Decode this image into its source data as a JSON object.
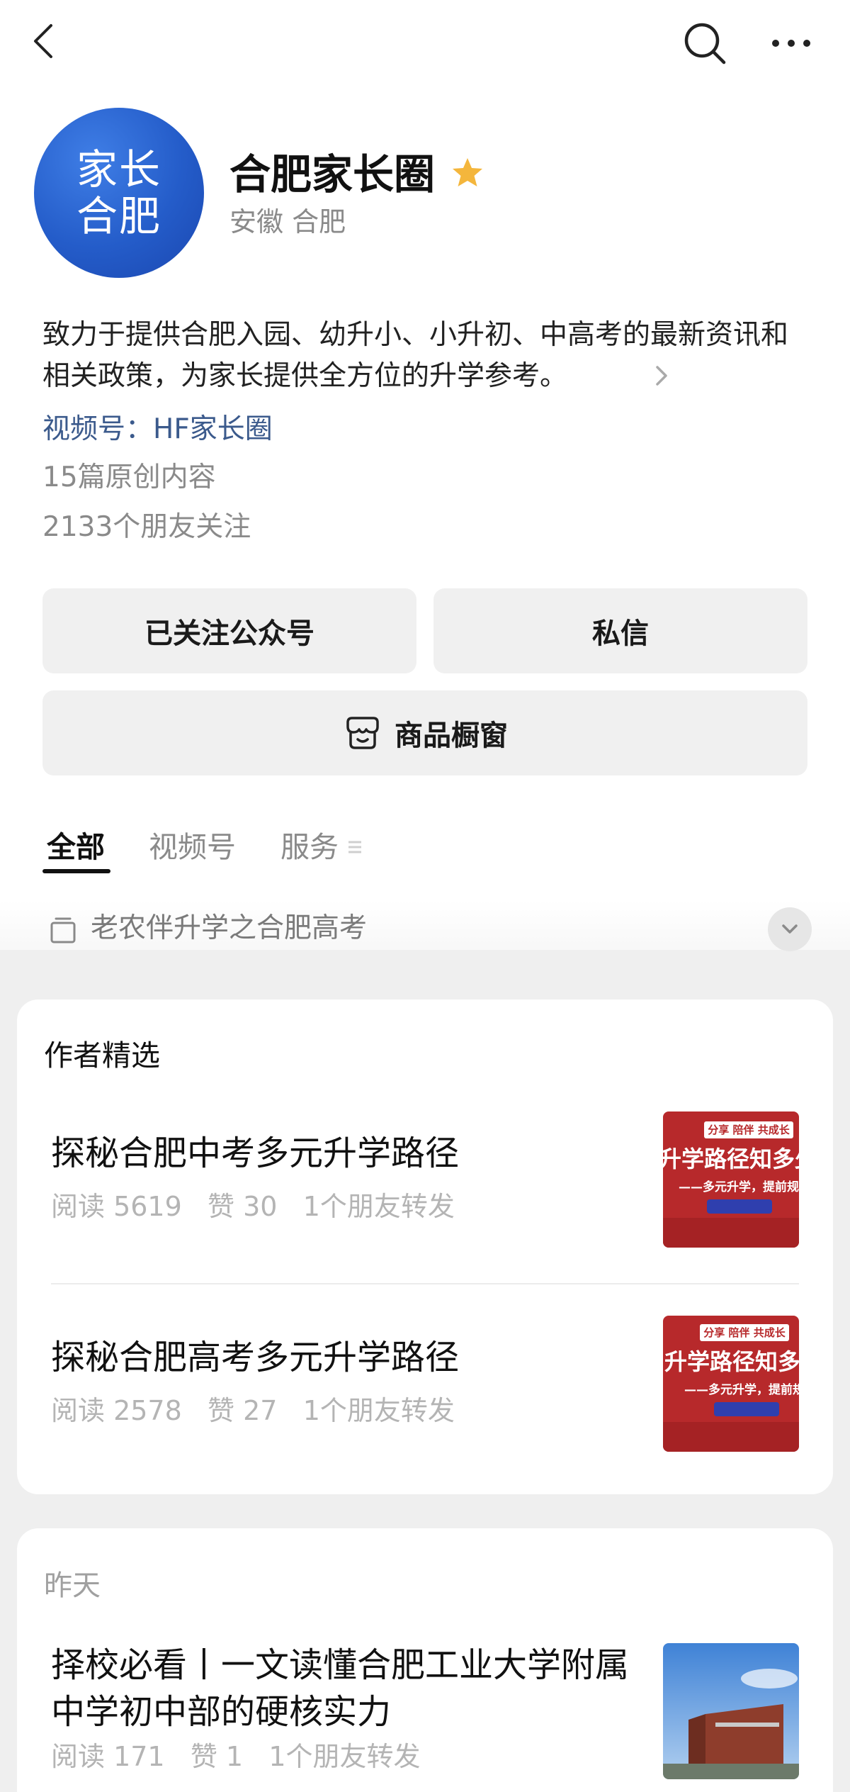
{
  "account": {
    "avatar_line1": "家长",
    "avatar_line2": "合肥",
    "name": "合肥家长圈",
    "location": "安徽 合肥",
    "description": "致力于提供合肥入园、幼升小、小升初、中高考的最新资讯和相关政策，为家长提供全方位的升学参考。",
    "video_channel": "视频号：HF家长圈",
    "original_count": "15篇原创内容",
    "friends_following": "2133个朋友关注"
  },
  "buttons": {
    "follow": "已关注公众号",
    "message": "私信",
    "shop": "商品橱窗"
  },
  "tabs": [
    {
      "label": "全部",
      "active": true
    },
    {
      "label": "视频号",
      "active": false
    },
    {
      "label": "服务",
      "active": false
    }
  ],
  "collection": {
    "label": "老农伴升学之合肥高考"
  },
  "featured": {
    "title": "作者精选",
    "articles": [
      {
        "title": "探秘合肥中考多元升学路径",
        "meta": "阅读 5619   赞 30   1个朋友转发",
        "thumb": {
          "banner": "分享 陪伴 共成长",
          "headline": "升学路径知多少",
          "sub": "——多元升学，提前规划"
        }
      },
      {
        "title": "探秘合肥高考多元升学路径",
        "meta": "阅读 2578   赞 27   1个朋友转发",
        "thumb": {
          "banner": "分享 陪伴 共成长",
          "headline": "升学路径知多少",
          "sub": "——多元升学，提前规划"
        }
      }
    ]
  },
  "recent": {
    "date": "昨天",
    "articles": [
      {
        "title": "择校必看丨一文读懂合肥工业大学附属中学初中部的硬核实力",
        "meta": "阅读 171   赞 1   1个朋友转发"
      }
    ]
  },
  "colors": {
    "avatar_blue": "#245cc9",
    "star": "#f4b63c",
    "link": "#3b5a8c",
    "thumb_red": "#b7292b"
  }
}
